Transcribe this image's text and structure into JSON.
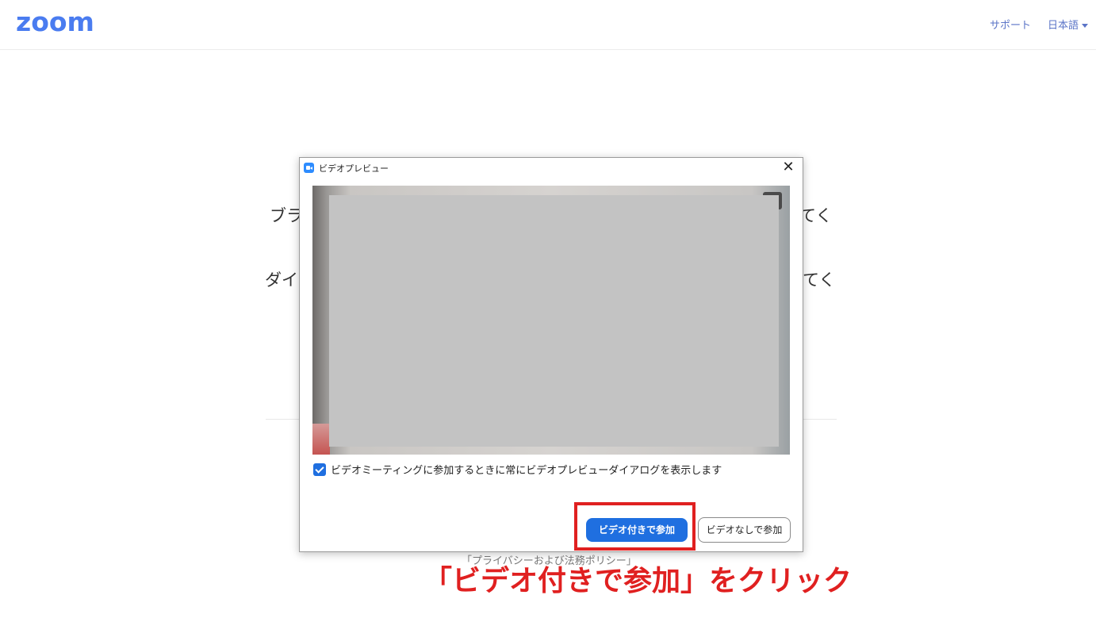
{
  "header": {
    "logo": "zoom",
    "nav_support": "サポート",
    "nav_language": "日本語"
  },
  "background": {
    "line1_left": "ブラ",
    "line1_right": "てく",
    "line2_left": "ダイ",
    "line2_right": "てく",
    "privacy_link": "「プライバシーおよび法務ポリシー」"
  },
  "dialog": {
    "title": "ビデオプレビュー",
    "close_glyph": "✕",
    "checkbox_label": "ビデオミーティングに参加するときに常にビデオプレビューダイアログを表示します",
    "checkbox_checked": true,
    "join_with_video": "ビデオ付きで参加",
    "join_without_video": "ビデオなしで参加"
  },
  "annotation": {
    "text": "「ビデオ付きで参加」をクリック",
    "color": "#e02020"
  },
  "colors": {
    "brand": "#4a7cf0",
    "primary_button": "#1f6fe0"
  }
}
